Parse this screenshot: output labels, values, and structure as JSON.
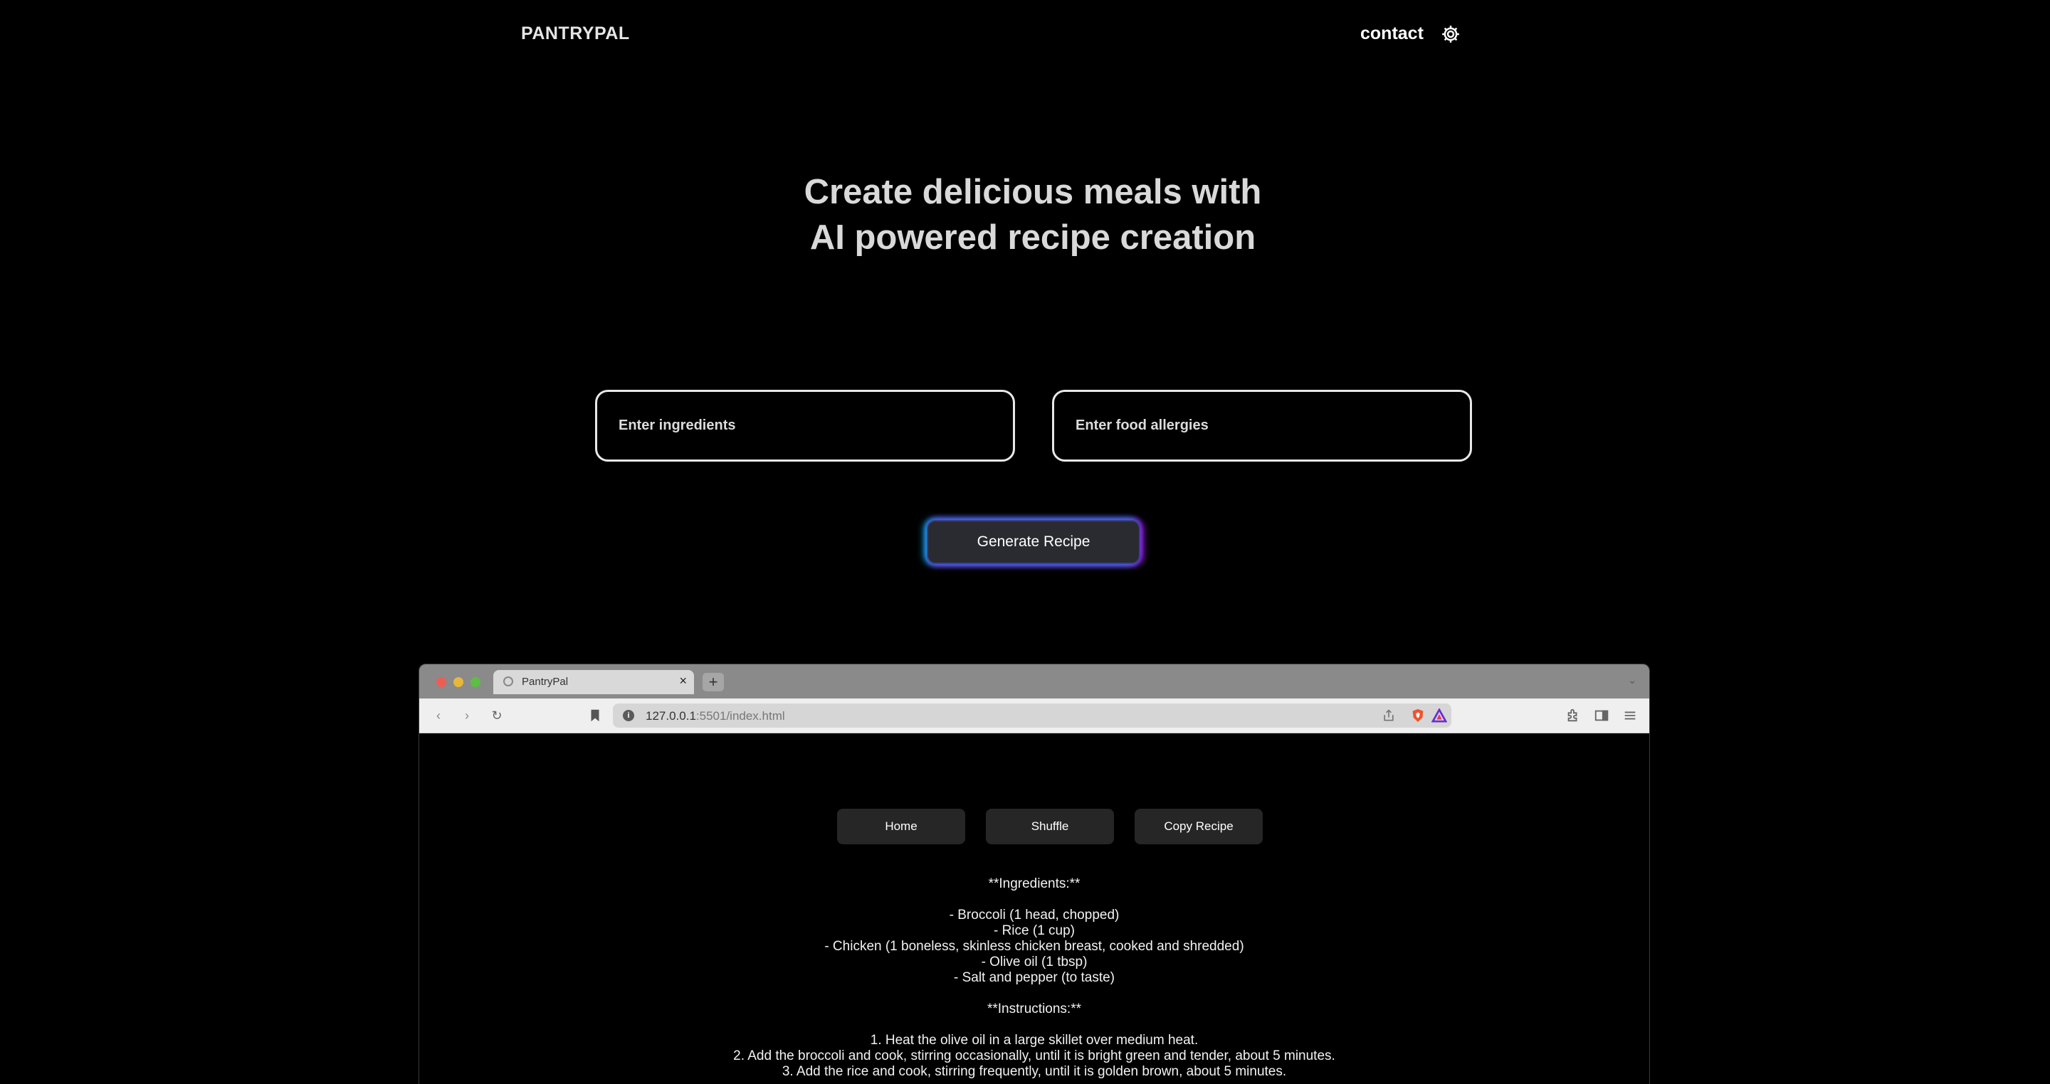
{
  "nav": {
    "brand": "PANTRYPAL",
    "contact": "contact",
    "settings_icon": "gear-icon"
  },
  "hero": {
    "line1": "Create delicious meals with",
    "line2": "AI powered recipe creation"
  },
  "form": {
    "ingredients_placeholder": "Enter ingredients",
    "allergies_placeholder": "Enter food allergies",
    "generate_label": "Generate Recipe"
  },
  "browser": {
    "tab_title": "PantryPal",
    "tab_close": "×",
    "new_tab": "+",
    "url_host": "127.0.0.1",
    "url_path": ":5501/index.html",
    "buttons": {
      "home": "Home",
      "shuffle": "Shuffle",
      "copy": "Copy Recipe"
    },
    "recipe": {
      "ingredients_heading": "**Ingredients:**",
      "ingredients": [
        "- Broccoli (1 head, chopped)",
        "- Rice (1 cup)",
        "- Chicken (1 boneless, skinless chicken breast, cooked and shredded)",
        "- Olive oil (1 tbsp)",
        "- Salt and pepper (to taste)"
      ],
      "instructions_heading": "**Instructions:**",
      "instructions": [
        "1. Heat the olive oil in a large skillet over medium heat.",
        "2. Add the broccoli and cook, stirring occasionally, until it is bright green and tender, about 5 minutes.",
        "3. Add the rice and cook, stirring frequently, until it is golden brown, about 5 minutes."
      ]
    }
  },
  "colors": {
    "background": "#000000",
    "field_border": "#e8e8e8",
    "button_bg": "#2a2b30",
    "glow_left": "#00beff",
    "glow_right": "#be00ff"
  }
}
